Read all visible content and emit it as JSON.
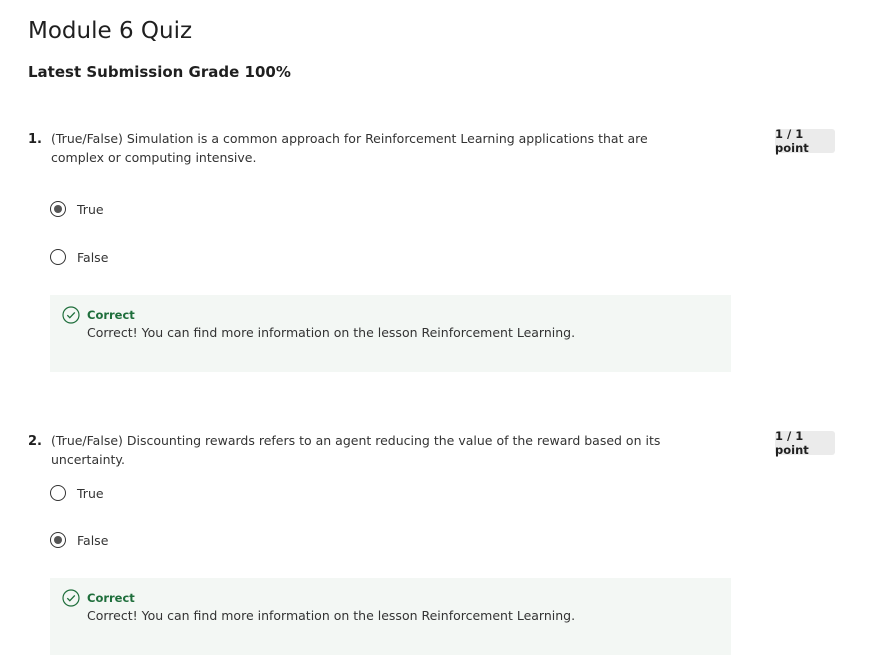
{
  "page": {
    "title": "Module 6 Quiz",
    "grade": "Latest Submission Grade 100%"
  },
  "questions": [
    {
      "number": "1.",
      "text": "(True/False) Simulation is a common approach for Reinforcement Learning applications that are complex or computing intensive.",
      "points": "1 / 1 point",
      "options": [
        {
          "label": "True",
          "selected": true
        },
        {
          "label": "False",
          "selected": false
        }
      ],
      "feedback": {
        "status": "Correct",
        "message": "Correct! You can find more information on the lesson Reinforcement Learning."
      }
    },
    {
      "number": "2.",
      "text": "(True/False) Discounting rewards refers to an agent reducing the value of the reward based on its uncertainty.",
      "points": "1 / 1 point",
      "options": [
        {
          "label": "True",
          "selected": false
        },
        {
          "label": "False",
          "selected": true
        }
      ],
      "feedback": {
        "status": "Correct",
        "message": "Correct! You can find more information on the lesson Reinforcement Learning."
      }
    }
  ],
  "icons": {
    "feedback": "check-circle-icon"
  },
  "colors": {
    "correct_green": "#1e6e3b",
    "feedback_bg": "#f3f7f4",
    "points_badge_bg": "#ebebeb"
  }
}
